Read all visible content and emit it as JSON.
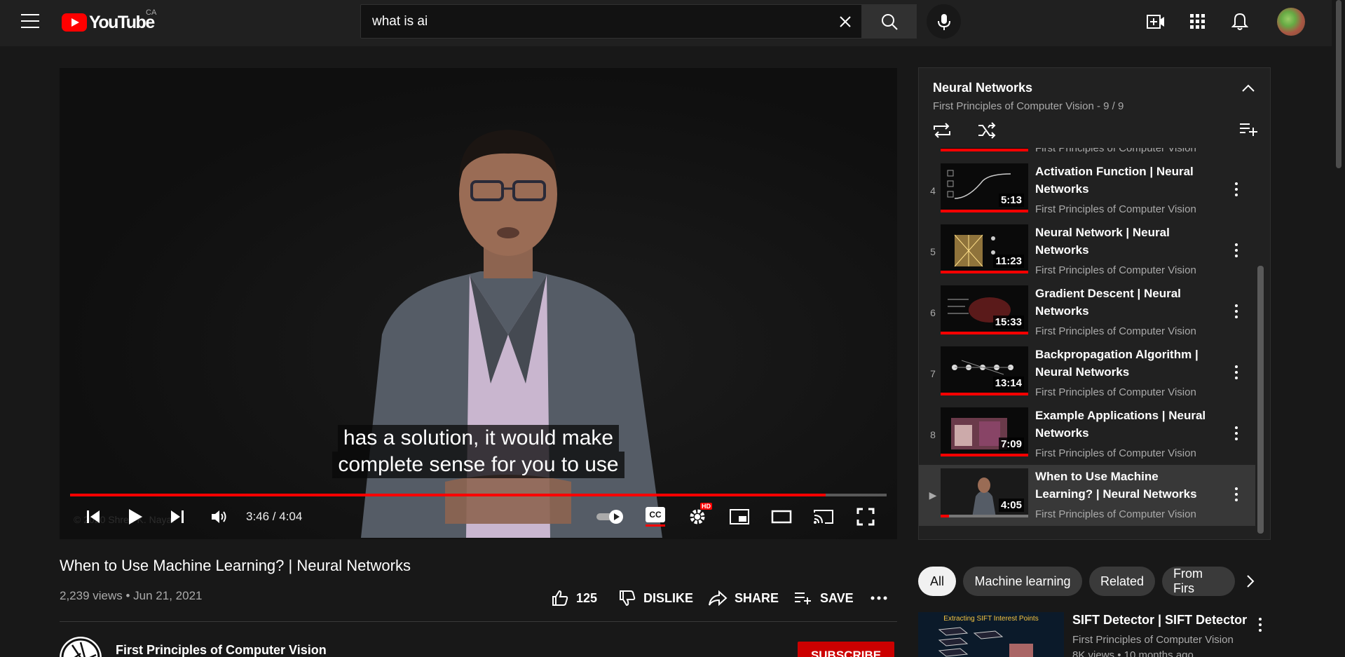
{
  "header": {
    "logo_text": "YouTube",
    "country": "CA",
    "search_value": "what is ai"
  },
  "player": {
    "caption_line1": "has a solution, it would make",
    "caption_line2": "complete sense for you to use",
    "time": "3:46 / 4:04",
    "progress": 0.925,
    "watermark": "© 2020 Shree K. Nayar",
    "hd_badge": "HD",
    "cc_label": "CC"
  },
  "video": {
    "title": "When to Use Machine Learning? | Neural Networks",
    "meta": "2,239 views • Jun 21, 2021",
    "likes": "125",
    "dislike_label": "DISLIKE",
    "share_label": "SHARE",
    "save_label": "SAVE",
    "channel": "First Principles of Computer Vision",
    "subscribe_label": "SUBSCRIBE"
  },
  "playlist": {
    "title": "Neural Networks",
    "subtitle": "First Principles of Computer Vision  - 9 / 9",
    "partial_channel": "First Principles of Computer Vision",
    "items": [
      {
        "index": "4",
        "title": "Activation Function | Neural Networks",
        "channel": "First Principles of Computer Vision",
        "duration": "5:13"
      },
      {
        "index": "5",
        "title": "Neural Network | Neural Networks",
        "channel": "First Principles of Computer Vision",
        "duration": "11:23"
      },
      {
        "index": "6",
        "title": "Gradient Descent | Neural Networks",
        "channel": "First Principles of Computer Vision",
        "duration": "15:33"
      },
      {
        "index": "7",
        "title": "Backpropagation Algorithm | Neural Networks",
        "channel": "First Principles of Computer Vision",
        "duration": "13:14"
      },
      {
        "index": "8",
        "title": "Example Applications | Neural Networks",
        "channel": "First Principles of Computer Vision",
        "duration": "7:09"
      },
      {
        "index": "▶",
        "title": "When to Use Machine Learning? | Neural Networks",
        "channel": "First Principles of Computer Vision",
        "duration": "4:05"
      }
    ]
  },
  "chips": [
    "All",
    "Machine learning",
    "Related",
    "From Firs"
  ],
  "recommendation": {
    "title": "SIFT Detector | SIFT Detector",
    "channel": "First Principles of Computer Vision",
    "views": "8K views • 10 months ago",
    "thumb_text": "Extracting SIFT Interest Points"
  },
  "colors": {
    "accent": "#ff0000",
    "subscribe": "#cc0000",
    "bg": "#181818"
  }
}
